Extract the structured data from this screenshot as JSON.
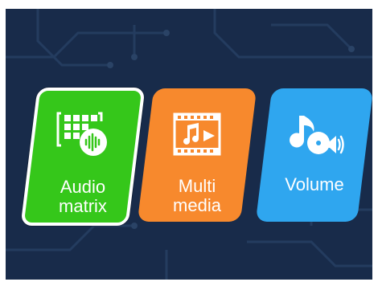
{
  "tiles": [
    {
      "label_line1": "Audio",
      "label_line2": "matrix",
      "icon": "audio-matrix-icon",
      "color": "#35c71a",
      "selected": true
    },
    {
      "label_line1": "Multi",
      "label_line2": "media",
      "icon": "multimedia-icon",
      "color": "#f7892d",
      "selected": false
    },
    {
      "label_line1": "Volume",
      "label_line2": "",
      "icon": "volume-icon",
      "color": "#2fa6ef",
      "selected": false
    }
  ],
  "colors": {
    "background": "#182b4a",
    "circuit": "#233a5c",
    "selected_border": "#ffffff"
  }
}
